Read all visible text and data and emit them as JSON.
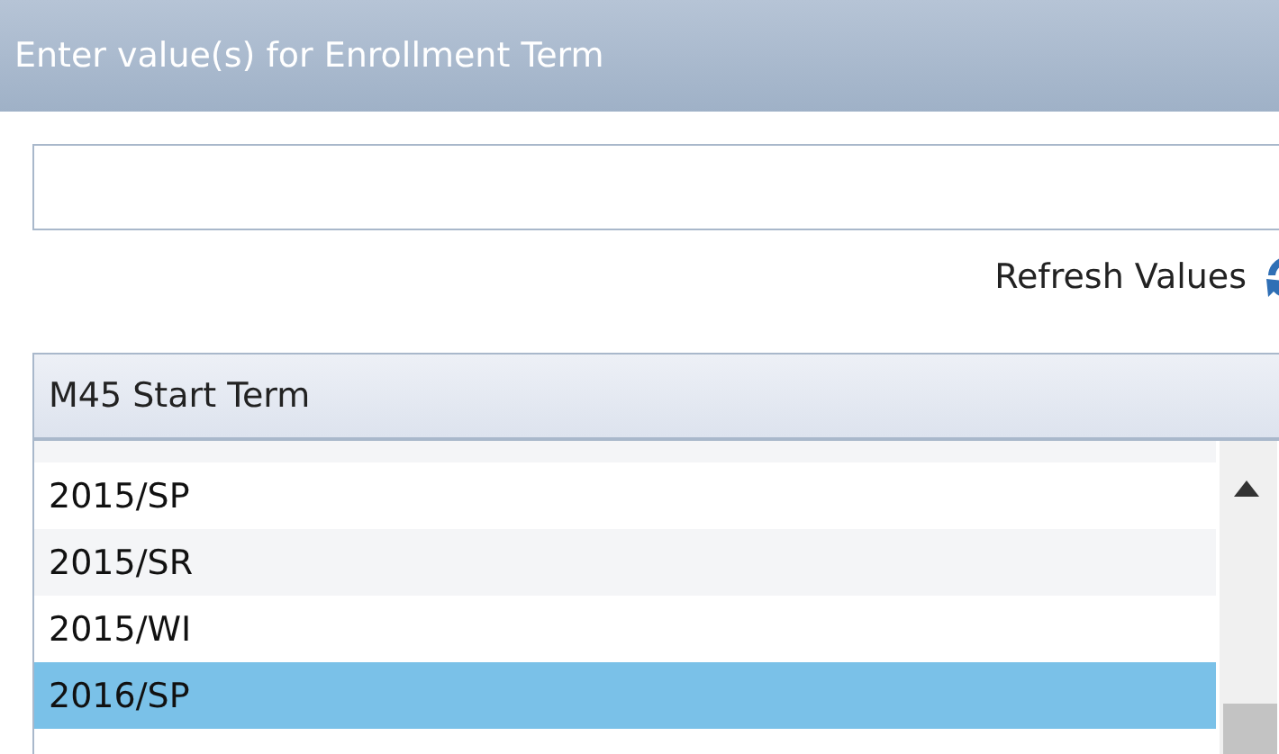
{
  "header": {
    "title": "Enter value(s) for Enrollment Term"
  },
  "refresh": {
    "label": "Refresh Values"
  },
  "list": {
    "column": "M45 Start Term",
    "items": [
      {
        "label": "2015/SP",
        "selected": false
      },
      {
        "label": "2015/SR",
        "selected": false
      },
      {
        "label": "2015/WI",
        "selected": false
      },
      {
        "label": "2016/SP",
        "selected": true
      }
    ]
  }
}
